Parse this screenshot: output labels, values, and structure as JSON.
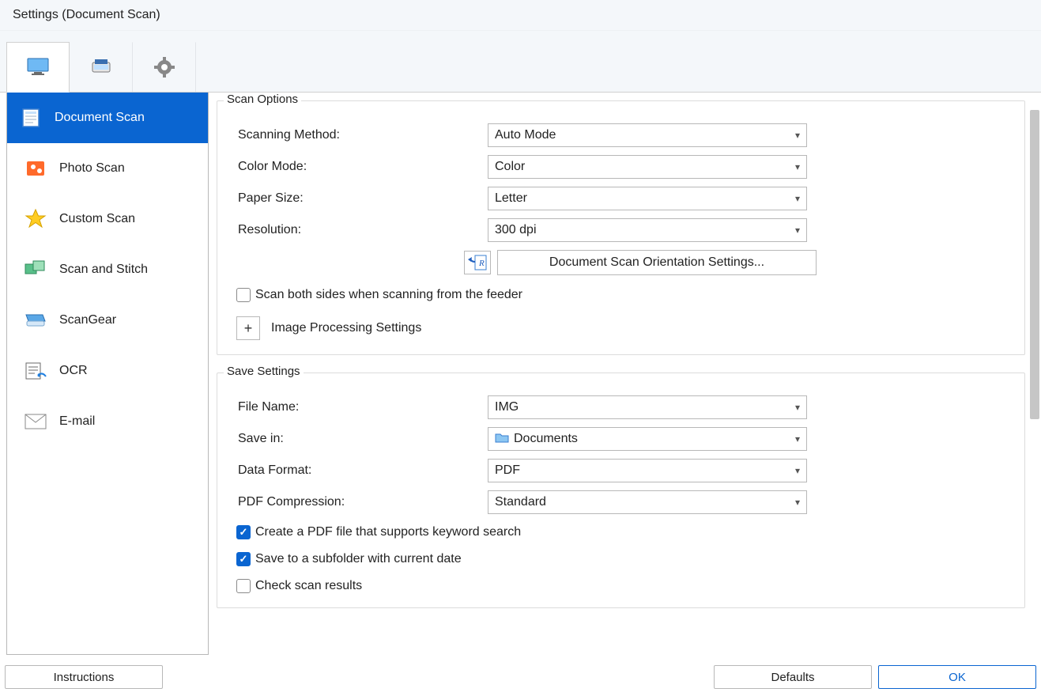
{
  "window": {
    "title": "Settings (Document Scan)"
  },
  "topTabs": [
    "computer",
    "scanner",
    "gear"
  ],
  "sidebar": {
    "items": [
      {
        "label": "Document Scan"
      },
      {
        "label": "Photo Scan"
      },
      {
        "label": "Custom Scan"
      },
      {
        "label": "Scan and Stitch"
      },
      {
        "label": "ScanGear"
      },
      {
        "label": "OCR"
      },
      {
        "label": "E-mail"
      }
    ]
  },
  "scanOptions": {
    "groupTitle": "Scan Options",
    "scanningMethodLabel": "Scanning Method:",
    "scanningMethodValue": "Auto Mode",
    "colorModeLabel": "Color Mode:",
    "colorModeValue": "Color",
    "paperSizeLabel": "Paper Size:",
    "paperSizeValue": "Letter",
    "resolutionLabel": "Resolution:",
    "resolutionValue": "300 dpi",
    "orientationButton": "Document Scan Orientation Settings...",
    "bothSidesLabel": "Scan both sides when scanning from the feeder",
    "imageProcessingLabel": "Image Processing Settings"
  },
  "saveSettings": {
    "groupTitle": "Save Settings",
    "fileNameLabel": "File Name:",
    "fileNameValue": "IMG",
    "saveInLabel": "Save in:",
    "saveInValue": "Documents",
    "dataFormatLabel": "Data Format:",
    "dataFormatValue": "PDF",
    "pdfCompressionLabel": "PDF Compression:",
    "pdfCompressionValue": "Standard",
    "pdfKeywordLabel": "Create a PDF file that supports keyword search",
    "subfolderLabel": "Save to a subfolder with current date",
    "checkResultsLabel": "Check scan results"
  },
  "footer": {
    "instructions": "Instructions",
    "defaults": "Defaults",
    "ok": "OK"
  }
}
